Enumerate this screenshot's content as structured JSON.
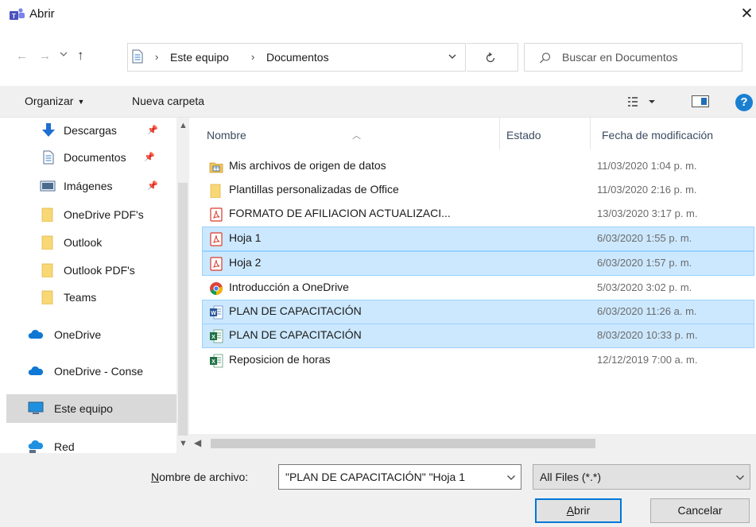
{
  "window": {
    "title": "Abrir",
    "close_glyph": "✕"
  },
  "nav": {
    "back_glyph": "←",
    "forward_glyph": "→",
    "recent_glyph": "⌄",
    "up_glyph": "↑"
  },
  "address": {
    "separator": "›",
    "crumbs": [
      "Este equipo",
      "Documentos"
    ]
  },
  "search": {
    "placeholder": "Buscar en Documentos"
  },
  "toolbar": {
    "organize_label": "Organizar",
    "new_folder_label": "Nueva carpeta",
    "help_label": "?"
  },
  "sidebar": {
    "items": [
      {
        "label": "Descargas",
        "icon": "download-arrow-icon",
        "pinned": true
      },
      {
        "label": "Documentos",
        "icon": "document-icon",
        "pinned": true
      },
      {
        "label": "Imágenes",
        "icon": "pictures-icon",
        "pinned": true
      },
      {
        "label": "OneDrive PDF's",
        "icon": "folder-icon",
        "pinned": false
      },
      {
        "label": "Outlook",
        "icon": "folder-icon",
        "pinned": false
      },
      {
        "label": "Outlook PDF's",
        "icon": "folder-icon",
        "pinned": false
      },
      {
        "label": "Teams",
        "icon": "folder-icon",
        "pinned": false
      },
      {
        "label": "OneDrive",
        "icon": "cloud-icon",
        "pinned": false
      },
      {
        "label": "OneDrive - Conse",
        "icon": "cloud-icon",
        "pinned": false
      },
      {
        "label": "Este equipo",
        "icon": "computer-icon",
        "pinned": false,
        "selected": true
      },
      {
        "label": "Red",
        "icon": "network-icon",
        "pinned": false
      }
    ]
  },
  "filelist": {
    "columns": [
      "Nombre",
      "Estado",
      "Fecha de modificación"
    ],
    "rows": [
      {
        "name": "Mis archivos de origen de datos",
        "date": "11/03/2020 1:04 p. m.",
        "icon": "data-sources-folder-icon",
        "selected": false
      },
      {
        "name": "Plantillas personalizadas de Office",
        "date": "11/03/2020 2:16 p. m.",
        "icon": "folder-icon",
        "selected": false
      },
      {
        "name": "FORMATO DE AFILIACION ACTUALIZACI...",
        "date": "13/03/2020 3:17 p. m.",
        "icon": "pdf-icon",
        "selected": false
      },
      {
        "name": "Hoja 1",
        "date": "6/03/2020 1:55 p. m.",
        "icon": "pdf-icon",
        "selected": true
      },
      {
        "name": "Hoja 2",
        "date": "6/03/2020 1:57 p. m.",
        "icon": "pdf-icon",
        "selected": true
      },
      {
        "name": "Introducción a OneDrive",
        "date": "5/03/2020 3:02 p. m.",
        "icon": "chrome-icon",
        "selected": false
      },
      {
        "name": "PLAN DE CAPACITACIÓN",
        "date": "6/03/2020 11:26 a. m.",
        "icon": "word-icon",
        "selected": true
      },
      {
        "name": "PLAN DE CAPACITACIÓN",
        "date": "8/03/2020 10:33 p. m.",
        "icon": "excel-icon",
        "selected": true
      },
      {
        "name": "Reposicion de horas",
        "date": "12/12/2019 7:00 a. m.",
        "icon": "excel-icon",
        "selected": false
      }
    ]
  },
  "footer": {
    "filename_label_accel": "N",
    "filename_label_rest": "ombre de archivo:",
    "filename_value": "\"PLAN DE CAPACITACIÓN\" \"Hoja 1",
    "filetype_value": "All Files (*.*)",
    "open_accel": "A",
    "open_rest": "brir",
    "cancel_label": "Cancelar"
  },
  "colors": {
    "selection_bg": "#cce8ff",
    "selection_border": "#99d1ff",
    "accent": "#0078d7",
    "pdf_red": "#d93a2b",
    "folder_yellow": "#f8d775",
    "excel_green": "#1e7145",
    "word_blue": "#2b579a"
  }
}
